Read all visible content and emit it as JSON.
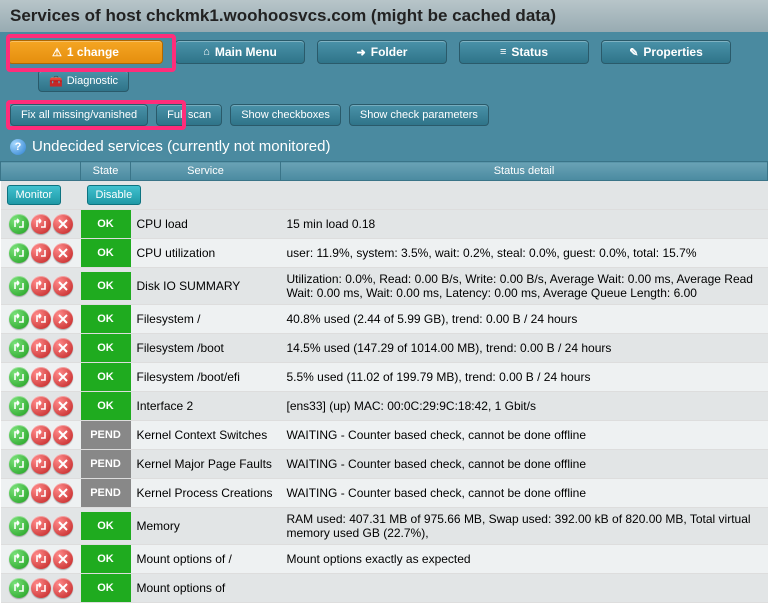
{
  "title": "Services of host chckmk1.woohoosvcs.com (might be cached data)",
  "toolbar": {
    "changes": "1 change",
    "main_menu": "Main Menu",
    "folder": "Folder",
    "status": "Status",
    "properties": "Properties",
    "diagnostic": "Diagnostic"
  },
  "actions": {
    "fix": "Fix all missing/vanished",
    "full_scan": "Full scan",
    "show_checkboxes": "Show checkboxes",
    "show_params": "Show check parameters"
  },
  "section": "Undecided services (currently not monitored)",
  "columns": {
    "actions": "",
    "state": "State",
    "service": "Service",
    "detail": "Status detail"
  },
  "row_buttons": {
    "monitor": "Monitor",
    "disable": "Disable"
  },
  "rows": [
    {
      "state": "OK",
      "service": "CPU load",
      "detail": "15 min load 0.18"
    },
    {
      "state": "OK",
      "service": "CPU utilization",
      "detail": "user: 11.9%, system: 3.5%, wait: 0.2%, steal: 0.0%, guest: 0.0%, total: 15.7%"
    },
    {
      "state": "OK",
      "service": "Disk IO SUMMARY",
      "detail": "Utilization: 0.0%, Read: 0.00 B/s, Write: 0.00 B/s, Average Wait: 0.00 ms, Average Read Wait: 0.00 ms, Wait: 0.00 ms, Latency: 0.00 ms, Average Queue Length: 6.00"
    },
    {
      "state": "OK",
      "service": "Filesystem /",
      "detail": "40.8% used (2.44 of 5.99 GB), trend: 0.00 B / 24 hours"
    },
    {
      "state": "OK",
      "service": "Filesystem /boot",
      "detail": "14.5% used (147.29 of 1014.00 MB), trend: 0.00 B / 24 hours"
    },
    {
      "state": "OK",
      "service": "Filesystem /boot/efi",
      "detail": "5.5% used (11.02 of 199.79 MB), trend: 0.00 B / 24 hours"
    },
    {
      "state": "OK",
      "service": "Interface 2",
      "detail": "[ens33] (up) MAC: 00:0C:29:9C:18:42, 1 Gbit/s"
    },
    {
      "state": "PEND",
      "service": "Kernel Context Switches",
      "detail": "WAITING - Counter based check, cannot be done offline"
    },
    {
      "state": "PEND",
      "service": "Kernel Major Page Faults",
      "detail": "WAITING - Counter based check, cannot be done offline"
    },
    {
      "state": "PEND",
      "service": "Kernel Process Creations",
      "detail": "WAITING - Counter based check, cannot be done offline"
    },
    {
      "state": "OK",
      "service": "Memory",
      "detail": "RAM used: 407.31 MB of 975.66 MB, Swap used: 392.00 kB of 820.00 MB, Total virtual memory used GB (22.7%),"
    },
    {
      "state": "OK",
      "service": "Mount options of /",
      "detail": "Mount options exactly as expected"
    },
    {
      "state": "OK",
      "service": "Mount options of",
      "detail": ""
    }
  ]
}
